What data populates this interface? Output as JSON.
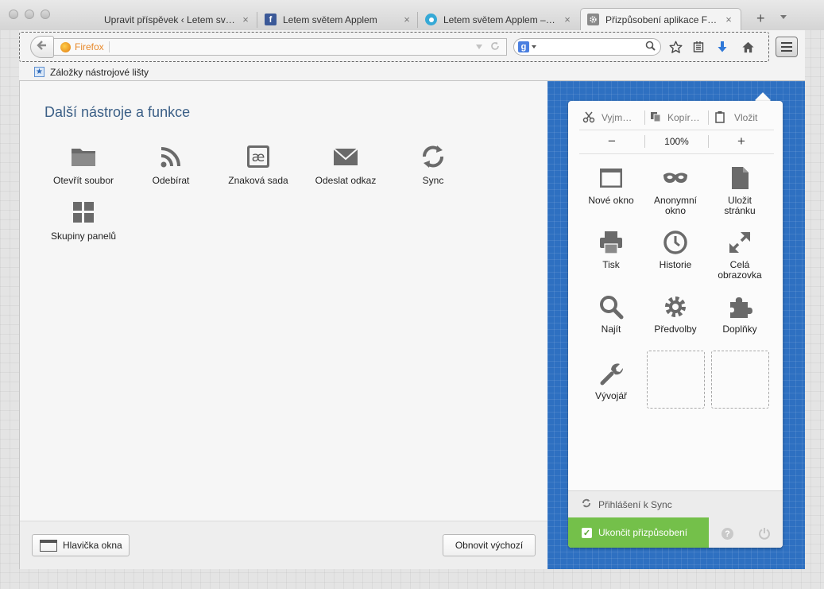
{
  "tabs": [
    {
      "label": "Upravit příspěvek ‹ Letem sv…",
      "favicon": "page-icon"
    },
    {
      "label": "Letem světem Applem",
      "favicon": "facebook-icon"
    },
    {
      "label": "Letem světem Applem – …",
      "favicon": "site-icon"
    },
    {
      "label": "Přizpůsobení aplikace Fir…",
      "favicon": "gear-icon"
    }
  ],
  "tab_close_glyph": "×",
  "new_tab_glyph": "+",
  "urlbar": {
    "identity": "Firefox",
    "value": ""
  },
  "searchbar": {
    "engine": "g",
    "value": ""
  },
  "bookmarks_toolbar": {
    "label": "Záložky nástrojové lišty"
  },
  "palette": {
    "title": "Další nástroje a funkce",
    "items": [
      {
        "label": "Otevřít soubor",
        "icon": "folder-icon"
      },
      {
        "label": "Odebírat",
        "icon": "rss-icon"
      },
      {
        "label": "Znaková sada",
        "icon": "charset-icon"
      },
      {
        "label": "Odeslat odkaz",
        "icon": "envelope-icon"
      },
      {
        "label": "Sync",
        "icon": "sync-icon"
      },
      {
        "label": "Skupiny panelů",
        "icon": "panel-groups-icon"
      }
    ],
    "charset_glyph": "æ"
  },
  "footer": {
    "titlebar_toggle": "Hlavička okna",
    "restore_defaults": "Obnovit výchozí"
  },
  "menu_panel": {
    "edit": {
      "cut": "Vyjm…",
      "copy": "Kopír…",
      "paste": "Vložit"
    },
    "zoom": {
      "out": "−",
      "level": "100%",
      "in": "+"
    },
    "items": [
      {
        "label": "Nové okno",
        "icon": "new-window-icon"
      },
      {
        "label": "Anonymní okno",
        "icon": "private-mask-icon"
      },
      {
        "label": "Uložit stránku",
        "icon": "save-page-icon"
      },
      {
        "label": "Tisk",
        "icon": "print-icon"
      },
      {
        "label": "Historie",
        "icon": "clock-icon"
      },
      {
        "label": "Celá obrazovka",
        "icon": "fullscreen-icon"
      },
      {
        "label": "Najít",
        "icon": "search-icon"
      },
      {
        "label": "Předvolby",
        "icon": "gear-icon"
      },
      {
        "label": "Doplňky",
        "icon": "puzzle-icon"
      },
      {
        "label": "Vývojář",
        "icon": "wrench-icon"
      }
    ],
    "sync_signin": "Přihlášení k Sync",
    "exit_customize": "Ukončit přizpůsobení",
    "help_glyph": "?",
    "checkbox_glyph": "✓"
  },
  "colors": {
    "accent_blue": "#2e70c1",
    "exit_green": "#74c04a",
    "heading_blue": "#3b5f86"
  }
}
